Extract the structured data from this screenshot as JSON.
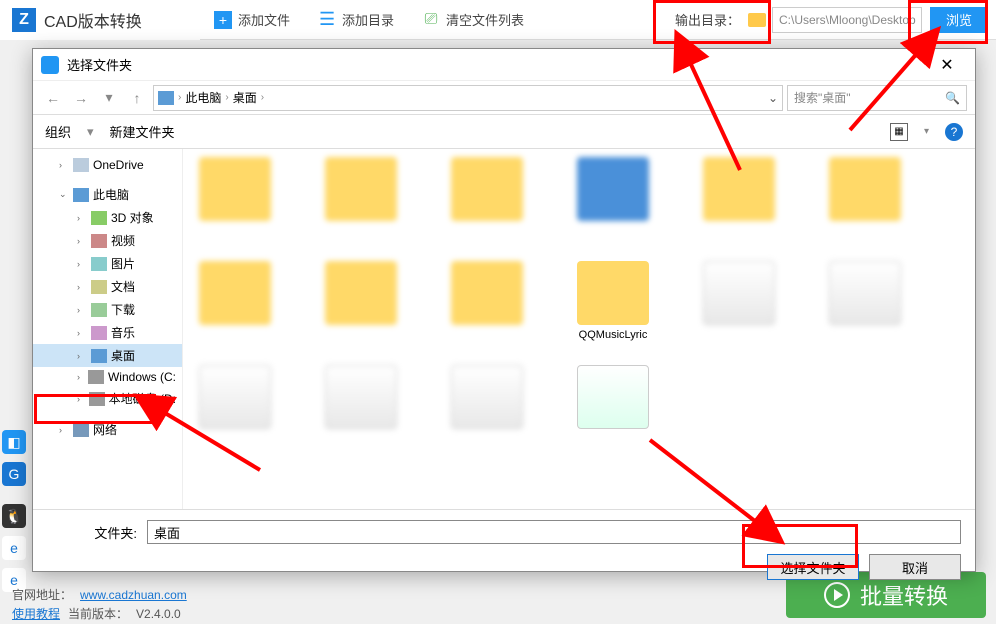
{
  "app": {
    "title": "CAD版本转换",
    "toolbar": {
      "add_file": "添加文件",
      "add_dir": "添加目录",
      "clear": "清空文件列表",
      "output_label": "输出目录：",
      "output_path": "C:\\Users\\Mloong\\Desktop",
      "browse": "浏览"
    },
    "footer": {
      "site_label": "官网地址：",
      "site_url": "www.cadzhuan.com",
      "tutorial": "使用教程",
      "version_label": "当前版本：",
      "version": "V2.4.0.0",
      "batch": "批量转换"
    }
  },
  "dialog": {
    "title": "选择文件夹",
    "close": "✕",
    "breadcrumb": {
      "pc": "此电脑",
      "desktop": "桌面"
    },
    "search_placeholder": "搜索\"桌面\"",
    "tools": {
      "organize": "组织",
      "new_folder": "新建文件夹"
    },
    "tree": {
      "onedrive": "OneDrive",
      "this_pc": "此电脑",
      "objects_3d": "3D 对象",
      "videos": "视频",
      "pictures": "图片",
      "documents": "文档",
      "downloads": "下载",
      "music": "音乐",
      "desktop": "桌面",
      "drive_c": "Windows (C:",
      "drive_d": "本地磁盘 (D:",
      "network": "网络"
    },
    "files": {
      "qqmusic": "QQMusicLyric"
    },
    "folder_label": "文件夹:",
    "folder_value": "桌面",
    "select_btn": "选择文件夹",
    "cancel_btn": "取消"
  }
}
